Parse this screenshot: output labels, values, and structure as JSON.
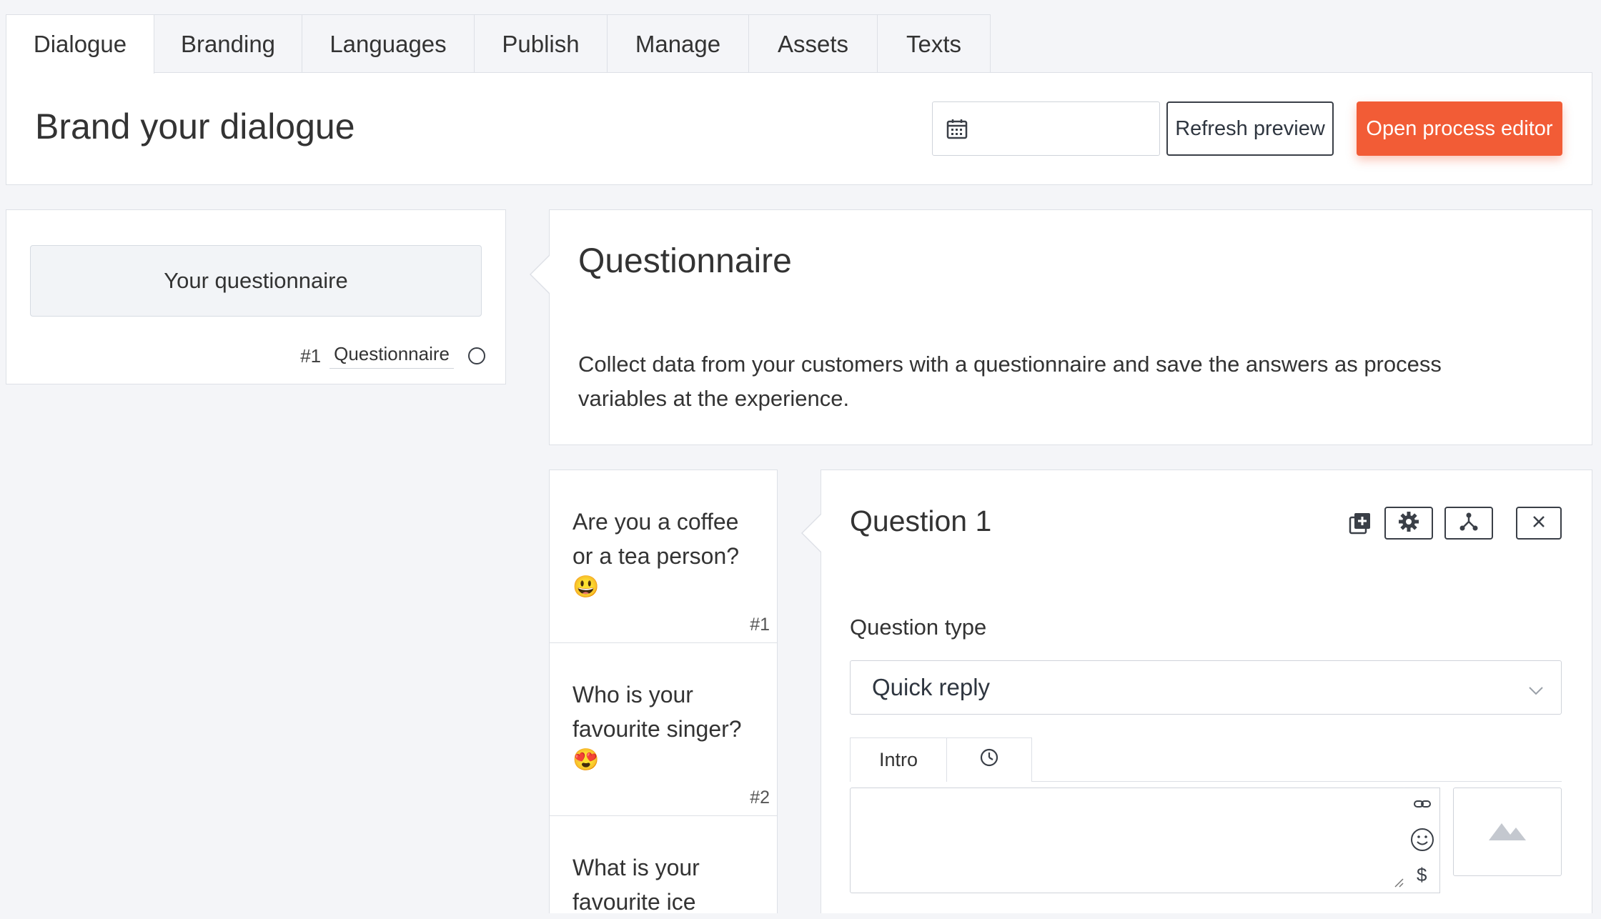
{
  "tabs": [
    {
      "label": "Dialogue"
    },
    {
      "label": "Branding"
    },
    {
      "label": "Languages"
    },
    {
      "label": "Publish"
    },
    {
      "label": "Manage"
    },
    {
      "label": "Assets"
    },
    {
      "label": "Texts"
    }
  ],
  "header": {
    "title": "Brand your dialogue",
    "date_value": "",
    "refresh_label": "Refresh preview",
    "open_editor_label": "Open process editor"
  },
  "left": {
    "card_label": "Your questionnaire",
    "item_number": "#1",
    "item_type": "Questionnaire"
  },
  "info": {
    "title": "Questionnaire",
    "description_line1": "Collect data from your customers with a questionnaire and save the answers as process",
    "description_line2": "variables at the experience."
  },
  "questions": [
    {
      "line1": "Are you a coffee",
      "line2": "or a tea person?",
      "emoji": "😃",
      "number": "#1"
    },
    {
      "line1": "Who is your",
      "line2": "favourite singer?",
      "emoji": "😍",
      "number": "#2"
    },
    {
      "line1": "What is your",
      "line2": "favourite ice",
      "emoji": "",
      "number": ""
    }
  ],
  "editor": {
    "title": "Question 1",
    "question_type_label": "Question type",
    "question_type_value": "Quick reply",
    "subtab_intro": "Intro",
    "textarea_value": "",
    "dollar_symbol": "$"
  },
  "colors": {
    "accent": "#f25c36",
    "background": "#f4f5f8",
    "border": "#dde0e6"
  }
}
